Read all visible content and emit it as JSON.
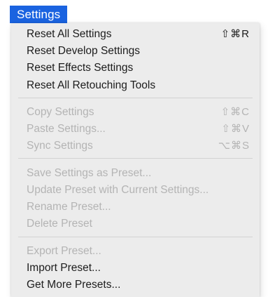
{
  "menu": {
    "title": "Settings",
    "items": [
      {
        "label": "Reset All Settings",
        "shortcut": "⇧⌘R",
        "enabled": true
      },
      {
        "label": "Reset Develop Settings",
        "shortcut": "",
        "enabled": true
      },
      {
        "label": "Reset Effects Settings",
        "shortcut": "",
        "enabled": true
      },
      {
        "label": "Reset All Retouching Tools",
        "shortcut": "",
        "enabled": true
      },
      {
        "label": "Copy Settings",
        "shortcut": "⇧⌘C",
        "enabled": false
      },
      {
        "label": "Paste Settings...",
        "shortcut": "⇧⌘V",
        "enabled": false
      },
      {
        "label": "Sync Settings",
        "shortcut": "⌥⌘S",
        "enabled": false
      },
      {
        "label": "Save Settings as Preset...",
        "shortcut": "",
        "enabled": false
      },
      {
        "label": "Update Preset with Current Settings...",
        "shortcut": "",
        "enabled": false
      },
      {
        "label": "Rename Preset...",
        "shortcut": "",
        "enabled": false
      },
      {
        "label": "Delete Preset",
        "shortcut": "",
        "enabled": false
      },
      {
        "label": "Export Preset...",
        "shortcut": "",
        "enabled": false
      },
      {
        "label": "Import Preset...",
        "shortcut": "",
        "enabled": true
      },
      {
        "label": "Get More Presets...",
        "shortcut": "",
        "enabled": true
      }
    ]
  },
  "colors": {
    "menu_title_bg": "#1a63e0",
    "menu_bg": "#ececec",
    "enabled_text": "#1c1c1c",
    "disabled_text": "#b4b4b4"
  }
}
